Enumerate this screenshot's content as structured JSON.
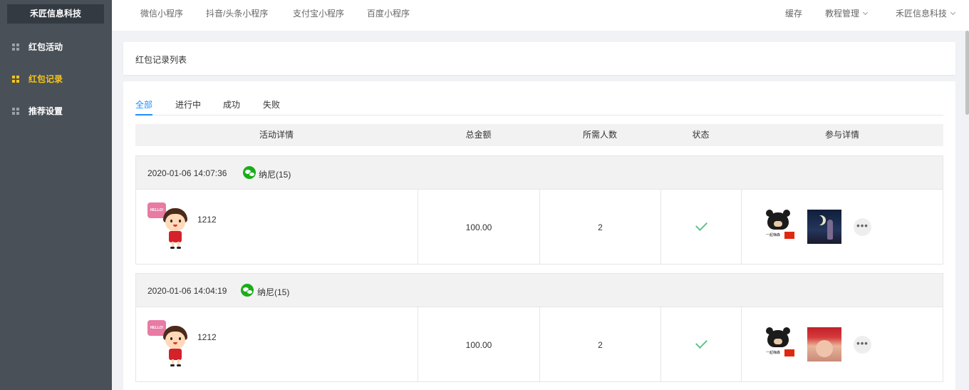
{
  "brand": "禾匠信息科技",
  "sidebar": {
    "items": [
      {
        "label": "红包活动",
        "active": false
      },
      {
        "label": "红包记录",
        "active": true
      },
      {
        "label": "推荐设置",
        "active": false
      }
    ]
  },
  "topbar": {
    "nav": [
      "微信小程序",
      "抖音/头条小程序",
      "支付宝小程序",
      "百度小程序"
    ],
    "right": {
      "cache": "缓存",
      "tutorial": "教程管理",
      "account": "禾匠信息科技"
    }
  },
  "page_title": "红包记录列表",
  "tabs": [
    {
      "label": "全部",
      "active": true
    },
    {
      "label": "进行中",
      "active": false
    },
    {
      "label": "成功",
      "active": false
    },
    {
      "label": "失败",
      "active": false
    }
  ],
  "table": {
    "columns": [
      "活动详情",
      "总金额",
      "所需人数",
      "状态",
      "参与详情"
    ],
    "records": [
      {
        "time": "2020-01-06 14:07:36",
        "user": "纳尼(15)",
        "activity_name": "1212",
        "amount": "100.00",
        "required": "2",
        "status": "success"
      },
      {
        "time": "2020-01-06 14:04:19",
        "user": "纳尼(15)",
        "activity_name": "1212",
        "amount": "100.00",
        "required": "2",
        "status": "success"
      }
    ]
  },
  "more_label": "•••",
  "colors": {
    "sidebar_bg": "#4a5058",
    "active": "#f5c518",
    "tab_active": "#1e90ff",
    "success": "#5fc28a",
    "wechat": "#1aad19"
  }
}
